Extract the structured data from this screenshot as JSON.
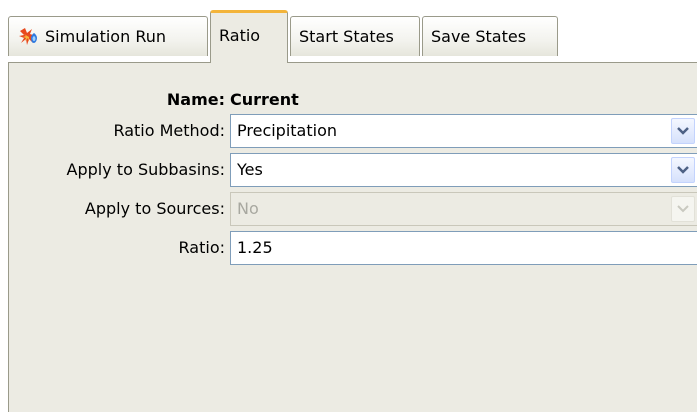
{
  "tabs": [
    {
      "label": "Simulation Run",
      "icon": "simulation-run-icon",
      "active": false
    },
    {
      "label": "Ratio",
      "active": true
    },
    {
      "label": "Start States",
      "active": false
    },
    {
      "label": "Save States",
      "active": false
    }
  ],
  "form": {
    "name_label": "Name:",
    "name_value": "Current",
    "ratio_method": {
      "label": "Ratio Method:",
      "value": "Precipitation"
    },
    "apply_subbasins": {
      "label": "Apply to Subbasins:",
      "value": "Yes"
    },
    "apply_sources": {
      "label": "Apply to Sources:",
      "value": "No",
      "disabled": true
    },
    "ratio": {
      "label": "Ratio:",
      "value": "1.25"
    }
  },
  "colors": {
    "active_tab_accent": "#f3b43a",
    "panel_bg": "#ecebe3",
    "field_border": "#7f9db9",
    "arrow": "#4d6185"
  }
}
